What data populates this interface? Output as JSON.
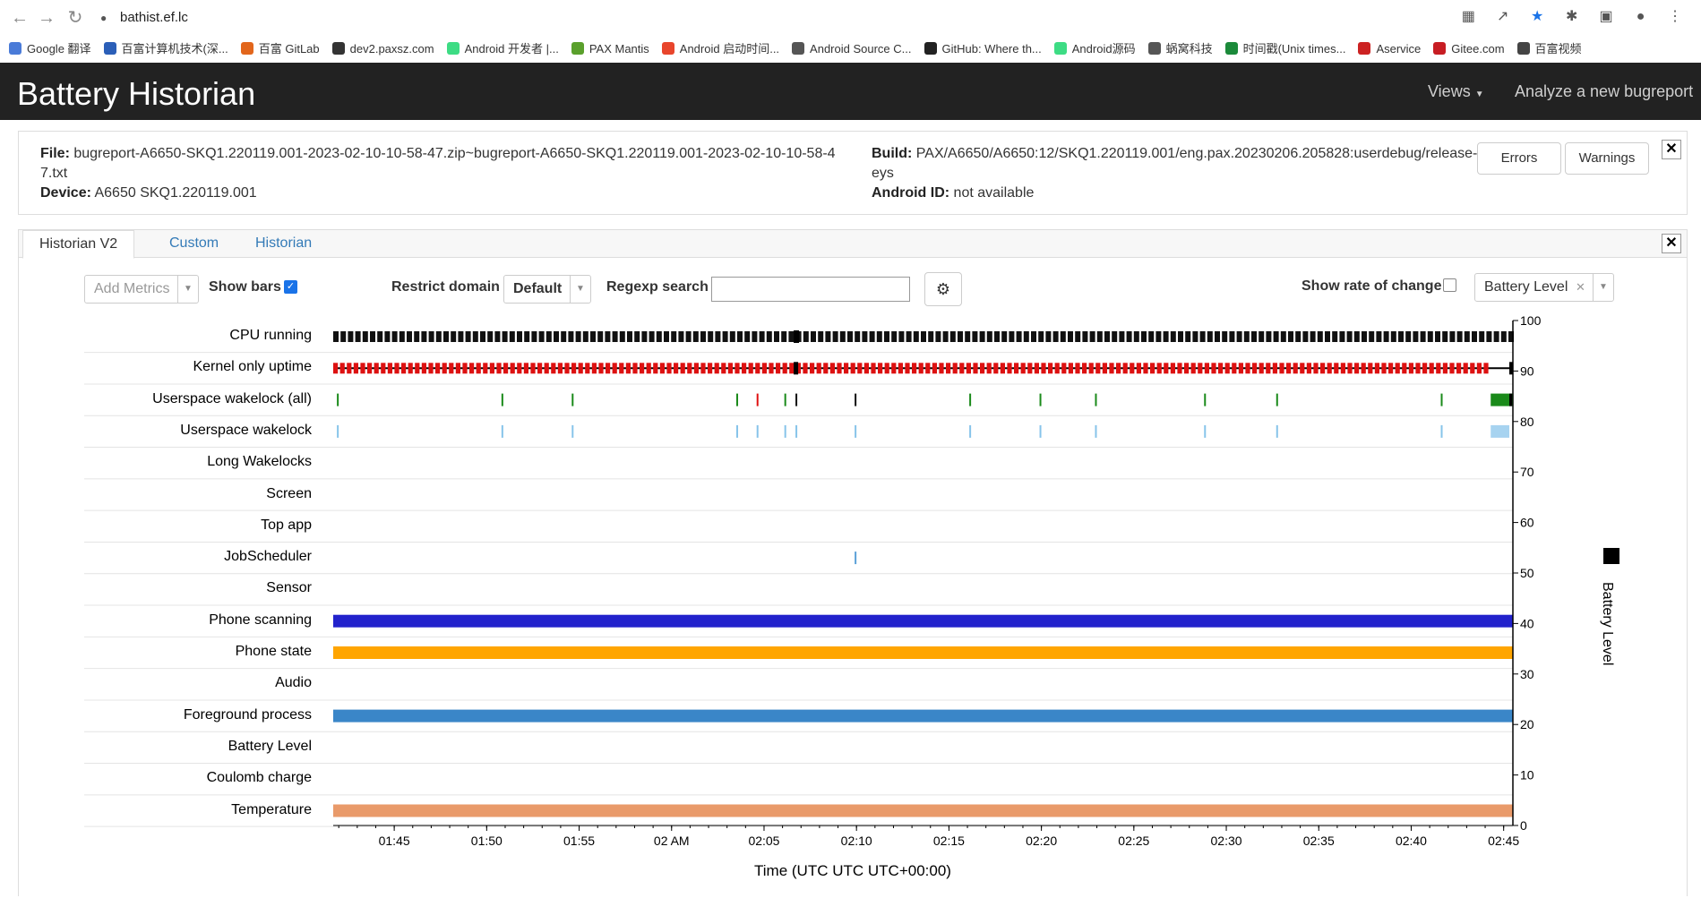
{
  "browser": {
    "url": "bathist.ef.lc",
    "bookmarks": [
      "Google 翻译",
      "百富计算机技术(深...",
      "百富 GitLab",
      "dev2.paxsz.com",
      "Android 开发者 |...",
      "PAX Mantis",
      "Android 启动时间...",
      "Android Source C...",
      "GitHub: Where th...",
      "Android源码",
      "蜗窝科技",
      "时间戳(Unix times...",
      "Aservice",
      "Gitee.com",
      "百富视频"
    ],
    "bookmark_colors": [
      "#4a7bd8",
      "#2b5fb8",
      "#e2661c",
      "#333333",
      "#3ddc84",
      "#5aa02c",
      "#e8452c",
      "#555555",
      "#222222",
      "#3ddc84",
      "#555555",
      "#1b8a3a",
      "#c22",
      "#c71d23",
      "#444444"
    ]
  },
  "header": {
    "title": "Battery Historian",
    "views": "Views",
    "analyze": "Analyze a new bugreport"
  },
  "info": {
    "file_label": "File:",
    "file_value": "bugreport-A6650-SKQ1.220119.001-2023-02-10-10-58-47.zip~bugreport-A6650-SKQ1.220119.001-2023-02-10-10-58-47.txt",
    "device_label": "Device:",
    "device_value": "A6650 SKQ1.220119.001",
    "build_label": "Build:",
    "build_value": "PAX/A6650/A6650:12/SKQ1.220119.001/eng.pax.20230206.205828:userdebug/release-keys",
    "android_id_label": "Android ID:",
    "android_id_value": "not available",
    "errors": "Errors",
    "warnings": "Warnings"
  },
  "tabs": [
    "Historian V2",
    "Custom",
    "Historian"
  ],
  "controls": {
    "add_metrics": "Add Metrics",
    "show_bars": "Show bars",
    "restrict_domain": "Restrict domain",
    "domain_value": "Default",
    "regexp_search": "Regexp search",
    "show_rate": "Show rate of change",
    "metric_select": "Battery Level"
  },
  "chart_data": {
    "type": "timeline",
    "rows": [
      "CPU running",
      "Kernel only uptime",
      "Userspace wakelock (all)",
      "Userspace wakelock",
      "Long Wakelocks",
      "Screen",
      "Top app",
      "JobScheduler",
      "Sensor",
      "Phone scanning",
      "Phone state",
      "Audio",
      "Foreground process",
      "Battery Level",
      "Coulomb charge",
      "Temperature"
    ],
    "x_ticks": [
      "01:45",
      "01:50",
      "01:55",
      "02 AM",
      "02:05",
      "02:10",
      "02:15",
      "02:20",
      "02:25",
      "02:30",
      "02:35",
      "02:40",
      "02:45"
    ],
    "xlabel": "Time (UTC UTC UTC+00:00)",
    "y2_ticks": [
      100,
      90,
      80,
      70,
      60,
      50,
      40,
      30,
      20,
      10,
      0
    ],
    "y2label": "Battery Level",
    "y2lim": [
      0,
      100
    ],
    "time_range_min": [
      0,
      63.8
    ],
    "tick_offsets_min": [
      3.3,
      8.3,
      13.3,
      18.3,
      23.3,
      28.3,
      33.3,
      38.3,
      43.3,
      48.3,
      53.3,
      58.3,
      63.3
    ],
    "full_bars": [
      {
        "row": "Phone scanning",
        "color": "#2222cc"
      },
      {
        "row": "Phone state",
        "color": "#ffa500"
      },
      {
        "row": "Foreground process",
        "color": "#3a86c8"
      },
      {
        "row": "Temperature",
        "color": "#e99a6a"
      }
    ],
    "wakelock_all_marks": [
      0.2,
      9.1,
      12.9,
      21.8,
      22.9,
      24.4,
      25.0,
      28.2,
      34.4,
      38.2,
      41.2,
      47.1,
      51.0,
      59.9
    ],
    "wakelock_all_colors": [
      "green",
      "green",
      "green",
      "green",
      "red",
      "green",
      "black",
      "black",
      "green",
      "green",
      "green",
      "green",
      "green",
      "green"
    ],
    "wakelock_marks": [
      0.2,
      9.1,
      12.9,
      21.8,
      22.9,
      24.4,
      25.0,
      28.2,
      34.4,
      38.2,
      41.2,
      47.1,
      51.0,
      59.9
    ],
    "wakelock_end_block": [
      62.6,
      63.8
    ],
    "jobscheduler_marks": [
      28.2
    ],
    "kernel_uptime_end": 62.3,
    "cpu_marker": 25.0
  }
}
